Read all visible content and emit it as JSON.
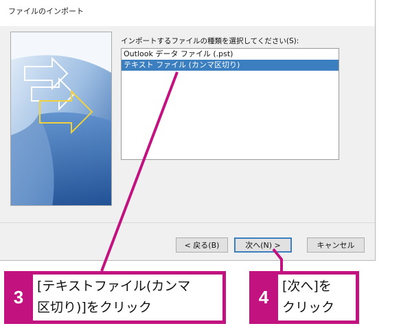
{
  "dialog": {
    "title": "ファイルのインポート",
    "prompt": "インポートするファイルの種類を選択してください(S):",
    "file_types": [
      {
        "label": "Outlook データ ファイル (.pst)",
        "selected": false
      },
      {
        "label": "テキスト ファイル (カンマ区切り)",
        "selected": true
      }
    ],
    "buttons": {
      "back": "< 戻る(B)",
      "next": "次へ(N) >",
      "cancel": "キャンセル"
    }
  },
  "callouts": [
    {
      "number": "3",
      "text": "[テキストファイル(カンマ\n区切り)]をクリック"
    },
    {
      "number": "4",
      "text": "[次へ]を\nクリック"
    }
  ],
  "colors": {
    "callout": "#c2127f",
    "selection": "#3c7fc1"
  }
}
